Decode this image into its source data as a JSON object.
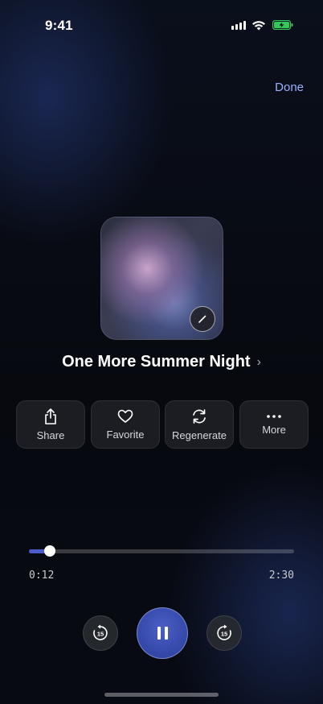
{
  "status": {
    "time": "9:41"
  },
  "header": {
    "done_label": "Done"
  },
  "track": {
    "title": "One More Summer Night"
  },
  "actions": [
    {
      "label": "Share",
      "icon": "share-icon"
    },
    {
      "label": "Favorite",
      "icon": "heart-icon"
    },
    {
      "label": "Regenerate",
      "icon": "regenerate-icon"
    },
    {
      "label": "More",
      "icon": "more-icon"
    }
  ],
  "progress": {
    "current": "0:12",
    "total": "2:30",
    "fraction": 0.08
  },
  "controls": {
    "skip_back_seconds": "15",
    "skip_forward_seconds": "15"
  },
  "colors": {
    "accent": "#4a5cc9",
    "done": "#9db0ff",
    "battery": "#35c759"
  }
}
